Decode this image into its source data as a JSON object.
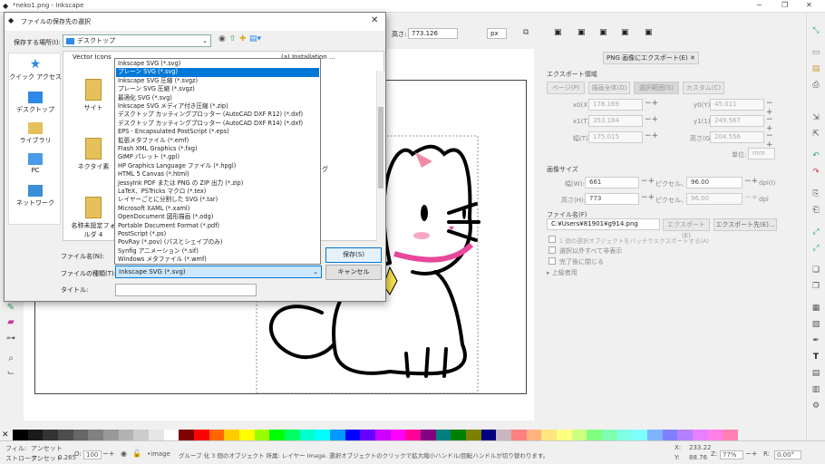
{
  "window": {
    "title": "*neko1.png - Inkscape"
  },
  "toolbar": {
    "height_label": "高さ:",
    "height_value": "773.126",
    "unit": "px"
  },
  "panel": {
    "tab_label": "PNG 画像にエクスポート(E)",
    "section_area": "エクスポート領域",
    "area_buttons": [
      "ページ(P)",
      "描画全体(D)",
      "選択範囲(S)",
      "カスタム(C)"
    ],
    "x0_label": "x0(X):",
    "x0": "178.169",
    "y0_label": "y0(Y):",
    "y0": "45.011",
    "x1_label": "x1(T):",
    "x1": "353.184",
    "y1_label": "y1(1):",
    "y1": "249.567",
    "width_label": "幅(T):",
    "width": "175.015",
    "height_label": "高さ(G):",
    "height": "204.556",
    "unit_label": "単位:",
    "unit": "mm",
    "image_size_label": "画像サイズ",
    "img_width_label": "幅(W):",
    "img_width": "661",
    "px_at_label": "ピクセル、",
    "dpi_value": "96.00",
    "dpi_label": "dpi(I)",
    "img_height_label": "高さ(H):",
    "img_height": "773",
    "dpi_value2": "96.00",
    "dpi_label2": "dpi",
    "filename_label": "ファイル名(F)",
    "filename": "C:¥Users¥81901¥g914.png",
    "export_button": "エクスポート(E)",
    "export_as_button": "エクスポート先(E)...",
    "check_batch": "1 個の選択オブジェクトをバッチでエクスポートする(A)",
    "check_hide": "選択以外すべて非表示",
    "check_close": "完了後に閉じる",
    "advanced": "上級者用"
  },
  "status": {
    "fill_label": "フィル:",
    "fill_value": "アンセット",
    "stroke_label": "ストローク:",
    "stroke_value": "アンセット",
    "stroke_width": "0.265",
    "opacity_label": "O:",
    "opacity_value": "100",
    "layer": "•image",
    "message": "グループ 化 3 個のオブジェクト 所属: レイヤー Image. 選択オブジェクトのクリックで拡大縮小ハンドル/回転ハンドルが切り替わります。",
    "x_label": "X:",
    "x_value": "233.22",
    "y_label": "Y:",
    "y_value": "88.76",
    "zoom_label": "Z:",
    "zoom_value": "77%",
    "rot_label": "R:",
    "rot_value": "0.00°"
  },
  "dialog": {
    "title": "ファイルの保存先の選択",
    "save_in_label": "保存する場所(I):",
    "save_in_value": "デスクトップ",
    "places": [
      "クイック アクセス",
      "デスクトップ",
      "ライブラリ",
      "PC",
      "ネットワーク"
    ],
    "files": [
      "Vector Icons",
      "サイト",
      "ネクタイ素",
      "名称未設定フォルダ 4"
    ],
    "partial_file": "(a) Installation ...",
    "partial_file2": "グ",
    "filename_label": "ファイル名(N):",
    "filetype_label": "ファイルの種類(T):",
    "filetype_value": "Inkscape SVG (*.svg)",
    "title_label": "タイトル:",
    "save_button": "保存(S)",
    "cancel_button": "キャンセル",
    "filetype_options": [
      "Inkscape SVG (*.svg)",
      "プレーン SVG (*.svg)",
      "Inkscape SVG 圧縮 (*.svgz)",
      "プレーン SVG 圧縮 (*.svgz)",
      "最適化 SVG (*.svg)",
      "Inkscape SVG メディア付き圧縮 (*.zip)",
      "デスクトップ カッティングプロッター (AutoCAD DXF R12) (*.dxf)",
      "デスクトップ カッティングプロッター (AutoCAD DXF R14) (*.dxf)",
      "EPS - Encapsulated PostScript (*.eps)",
      "拡張メタファイル (*.emf)",
      "Flash XML Graphics (*.fxg)",
      "GIMP パレット (*.gpl)",
      "HP Graphics Language ファイル (*.hpgl)",
      "HTML 5 Canvas (*.html)",
      "JessyInk PDF または PNG の ZIP 出力 (*.zip)",
      "LaTeX、PSTricks マクロ (*.tex)",
      "レイヤーごとに分割した SVG (*.tar)",
      "Microsoft XAML (*.xaml)",
      "OpenDocument 図形描画 (*.odg)",
      "Portable Document Format (*.pdf)",
      "PostScript (*.ps)",
      "PovRay (*.pov) (パスとシェイプのみ)",
      "Synfig アニメーション (*.sif)",
      "Windows メタファイル (*.wmf)"
    ],
    "selected_option_index": 1
  },
  "palette_colors": [
    "#000000",
    "#1a1a1a",
    "#333333",
    "#4d4d4d",
    "#666666",
    "#808080",
    "#999999",
    "#b3b3b3",
    "#cccccc",
    "#e6e6e6",
    "#ffffff",
    "#800000",
    "#ff0000",
    "#ff6600",
    "#ffcc00",
    "#ffff00",
    "#99ff00",
    "#00ff00",
    "#00ff66",
    "#00ffcc",
    "#00ffff",
    "#0099ff",
    "#0000ff",
    "#6600ff",
    "#cc00ff",
    "#ff00ff",
    "#ff0099",
    "#800080",
    "#008080",
    "#008000",
    "#808000",
    "#000080",
    "#c8b7be",
    "#ff8080",
    "#ffb380",
    "#ffe680",
    "#ffff80",
    "#ccff80",
    "#80ff80",
    "#80ffb3",
    "#80ffe6",
    "#80ffff",
    "#80b3ff",
    "#8080ff",
    "#b380ff",
    "#e680ff",
    "#ff80e6",
    "#ff80b3"
  ]
}
